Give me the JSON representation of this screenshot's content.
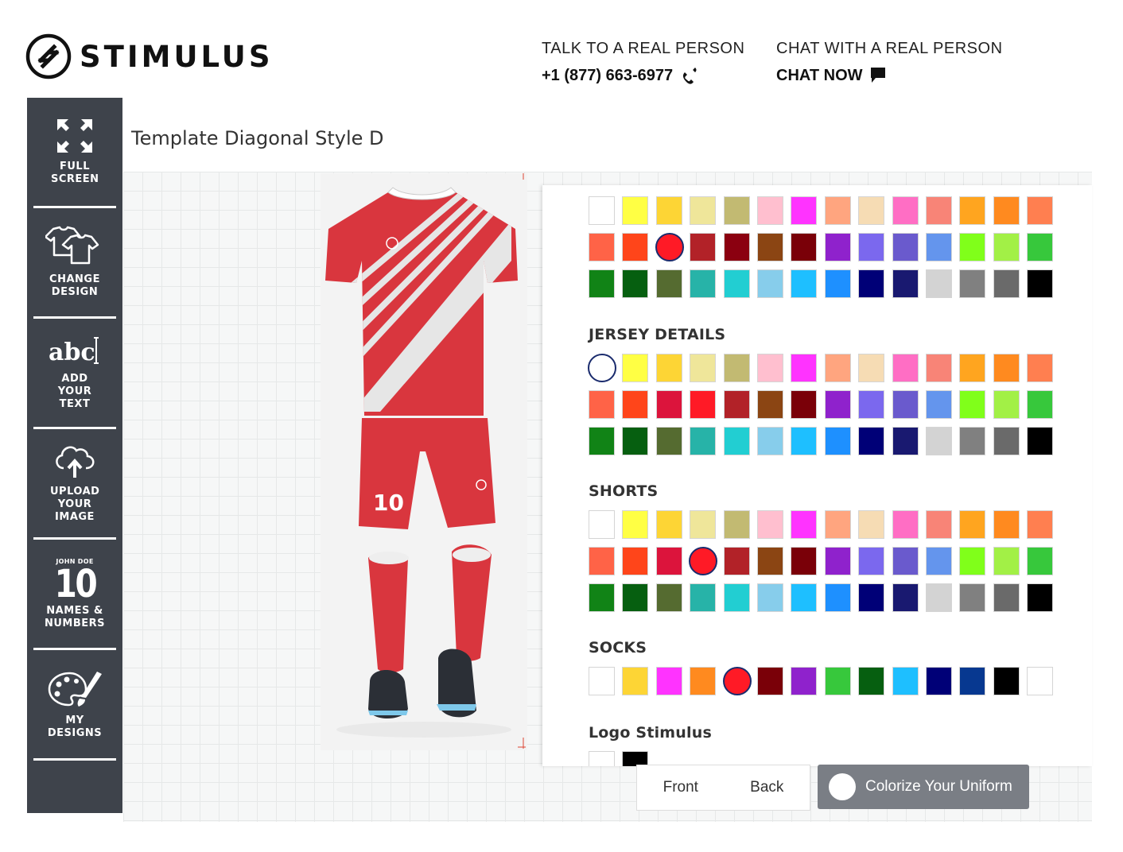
{
  "brand": {
    "name": "STIMULUS"
  },
  "contact": {
    "talk_label": "TALK TO A REAL PERSON",
    "phone": "+1 (877) 663-6977",
    "chat_label": "CHAT WITH A REAL PERSON",
    "chat_now": "CHAT NOW"
  },
  "sidebar": {
    "items": [
      {
        "label": "FULL SCREEN",
        "icon": "fullscreen-icon"
      },
      {
        "label": "CHANGE DESIGN",
        "icon": "tshirts-icon"
      },
      {
        "label": "ADD YOUR TEXT",
        "icon": "text-icon"
      },
      {
        "label": "UPLOAD YOUR IMAGE",
        "icon": "cloud-upload-icon"
      },
      {
        "label": "NAMES & NUMBERS",
        "icon": "name-number-icon",
        "icon_name": "JOHN DOE",
        "icon_number": "10"
      },
      {
        "label": "MY DESIGNS",
        "icon": "palette-icon"
      }
    ]
  },
  "design_title": "Template Diagonal Style D",
  "uniform": {
    "number": "10",
    "jersey_color": "#d9363e",
    "stripe_color": "#e6e6e6"
  },
  "palette": {
    "top": {
      "colors": [
        "#ffffff",
        "#ffff44",
        "#fdd535",
        "#efe69a",
        "#c2ba72",
        "#ffbfcf",
        "#ff33ff",
        "#ffa57f",
        "#f6dcb4",
        "#ff6ec4",
        "#f88477",
        "#ffa51f",
        "#ff8a1f",
        "#ff7f50",
        "#ff6347",
        "#ff451a",
        "#ff1a26",
        "#b22228",
        "#8b0010",
        "#8b4513",
        "#7a0008",
        "#8f22cc",
        "#7b68ee",
        "#6a5acd",
        "#6495ed",
        "#80ff1a",
        "#a2f046",
        "#37c83c",
        "#118316",
        "#065f10",
        "#556b30",
        "#27b3a8",
        "#22ced2",
        "#87cdeb",
        "#1ebfff",
        "#1e90ff",
        "#000077",
        "#191970",
        "#d3d3d3",
        "#808080",
        "#6a6a6a",
        "#000000"
      ],
      "selected": 16
    },
    "jersey_details": {
      "title": "JERSEY DETAILS",
      "colors": [
        "#ffffff",
        "#ffff44",
        "#fdd535",
        "#efe69a",
        "#c2ba72",
        "#ffbfcf",
        "#ff33ff",
        "#ffa57f",
        "#f6dcb4",
        "#ff6ec4",
        "#f88477",
        "#ffa51f",
        "#ff8a1f",
        "#ff7f50",
        "#ff6347",
        "#ff451a",
        "#dc143c",
        "#ff1a26",
        "#b22228",
        "#8b4513",
        "#7a0008",
        "#8f22cc",
        "#7b68ee",
        "#6a5acd",
        "#6495ed",
        "#80ff1a",
        "#a2f046",
        "#37c83c",
        "#118316",
        "#065f10",
        "#556b30",
        "#27b3a8",
        "#22ced2",
        "#87cdeb",
        "#1ebfff",
        "#1e90ff",
        "#000077",
        "#191970",
        "#d3d3d3",
        "#808080",
        "#6a6a6a",
        "#000000"
      ],
      "selected": 0
    },
    "shorts": {
      "title": "SHORTS",
      "colors": [
        "#ffffff",
        "#ffff44",
        "#fdd535",
        "#efe69a",
        "#c2ba72",
        "#ffbfcf",
        "#ff33ff",
        "#ffa57f",
        "#f6dcb4",
        "#ff6ec4",
        "#f88477",
        "#ffa51f",
        "#ff8a1f",
        "#ff7f50",
        "#ff6347",
        "#ff451a",
        "#dc143c",
        "#ff1a26",
        "#b22228",
        "#8b4513",
        "#7a0008",
        "#8f22cc",
        "#7b68ee",
        "#6a5acd",
        "#6495ed",
        "#80ff1a",
        "#a2f046",
        "#37c83c",
        "#118316",
        "#065f10",
        "#556b30",
        "#27b3a8",
        "#22ced2",
        "#87cdeb",
        "#1ebfff",
        "#1e90ff",
        "#000077",
        "#191970",
        "#d3d3d3",
        "#808080",
        "#6a6a6a",
        "#000000"
      ],
      "selected": 17
    },
    "socks": {
      "title": "SOCKS",
      "colors": [
        "#ffffff",
        "#fdd535",
        "#ff33ff",
        "#ff8a1f",
        "#ff1a26",
        "#7a0008",
        "#8f22cc",
        "#37c83c",
        "#065f10",
        "#1ebfff",
        "#000077",
        "#073890",
        "#000000",
        "#ffffff"
      ],
      "selected": 4
    },
    "logo": {
      "title": "Logo Stimulus",
      "colors": [
        "#ffffff",
        "#000000"
      ],
      "selected": -1
    }
  },
  "controls": {
    "front": "Front",
    "back": "Back",
    "colorize": "Colorize Your Uniform"
  }
}
